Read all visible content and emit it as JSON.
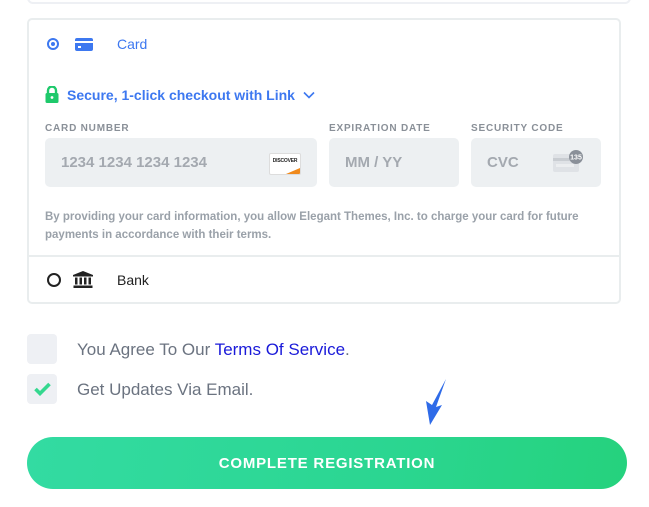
{
  "payment_methods": {
    "card": {
      "label": "Card",
      "selected": true,
      "icon": "credit-card-icon"
    },
    "link": {
      "text": "Secure, 1-click checkout with Link",
      "icon": "lock-icon",
      "chevron": "chevron-down-icon"
    },
    "fields": {
      "card_number": {
        "label": "CARD NUMBER",
        "placeholder": "1234 1234 1234 1234",
        "value": "",
        "brand_icon": "discover-icon",
        "brand_text": "DISCOVER"
      },
      "expiration": {
        "label": "EXPIRATION DATE",
        "placeholder": "MM / YY",
        "value": ""
      },
      "security_code": {
        "label": "SECURITY CODE",
        "placeholder": "CVC",
        "value": "",
        "hint_icon": "cvc-card-icon",
        "hint_number": "135"
      }
    },
    "disclaimer": "By providing your card information, you allow Elegant Themes, Inc. to charge your card for future payments in accordance with their terms.",
    "bank": {
      "label": "Bank",
      "selected": false,
      "icon": "bank-icon"
    }
  },
  "agreements": {
    "terms": {
      "checked": false,
      "prefix": "You Agree To Our ",
      "link_text": "Terms Of Service",
      "suffix": "."
    },
    "updates": {
      "checked": true,
      "label": "Get Updates Via Email."
    }
  },
  "submit": {
    "label": "COMPLETE REGISTRATION"
  },
  "colors": {
    "accent_blue": "#3d78f0",
    "success_green": "#2bd691",
    "link_blue": "#1a1ad9"
  }
}
